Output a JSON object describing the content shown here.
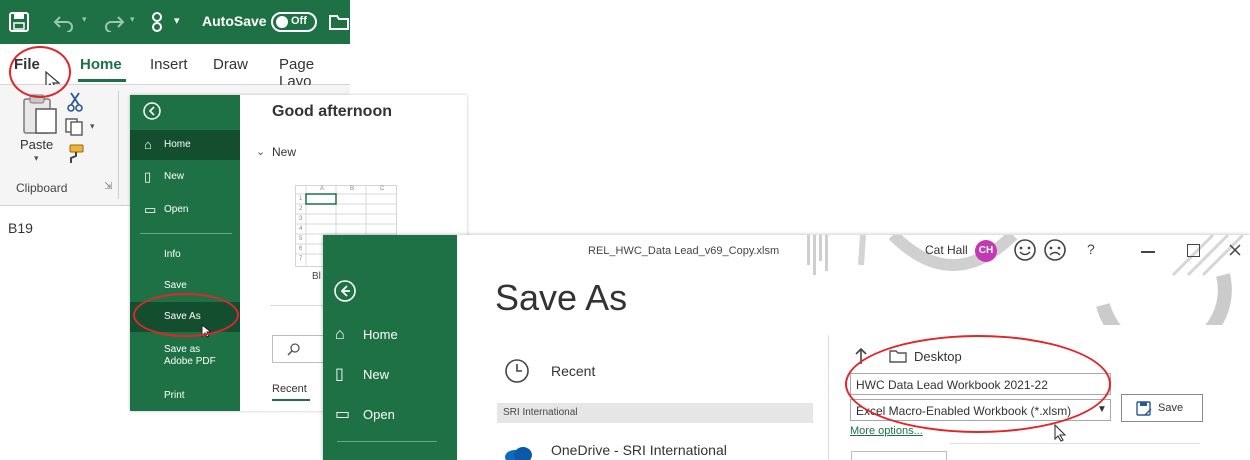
{
  "excel_ribbon": {
    "autosave_label": "AutoSave",
    "autosave_state": "Off",
    "tabs": [
      "File",
      "Home",
      "Insert",
      "Draw",
      "Page Layo"
    ],
    "clipboard": {
      "paste_label": "Paste",
      "group_label": "Clipboard"
    },
    "cell_ref": "B19"
  },
  "backstage_home": {
    "nav_items": [
      "Home",
      "New",
      "Open",
      "Info",
      "Save",
      "Save As",
      "Save as Adobe PDF",
      "Print"
    ],
    "greeting": "Good afternoon",
    "new_section": "New",
    "blank_caption": "Bl",
    "recent_tab": "Recent",
    "sheet_cols": [
      "A",
      "B",
      "C"
    ],
    "sheet_rows": [
      "1",
      "2",
      "3",
      "4",
      "5",
      "6",
      "7"
    ]
  },
  "save_as": {
    "window_title": "REL_HWC_Data Lead_v69_Copy.xlsm",
    "user_name": "Cat Hall",
    "user_initials": "CH",
    "help": "?",
    "page_title": "Save As",
    "nav_items": [
      "Home",
      "New",
      "Open"
    ],
    "recent_label": "Recent",
    "group_header": "SRI International",
    "onedrive_label": "OneDrive - SRI International",
    "location": "Desktop",
    "file_name": "HWC Data Lead Workbook 2021-22",
    "file_type": "Excel Macro-Enabled Workbook (*.xlsm)",
    "more_options": "More options...",
    "save_button": "Save",
    "accent_color": "#1e7145",
    "avatar_color": "#c239b3",
    "highlight_color": "#e0262a"
  }
}
